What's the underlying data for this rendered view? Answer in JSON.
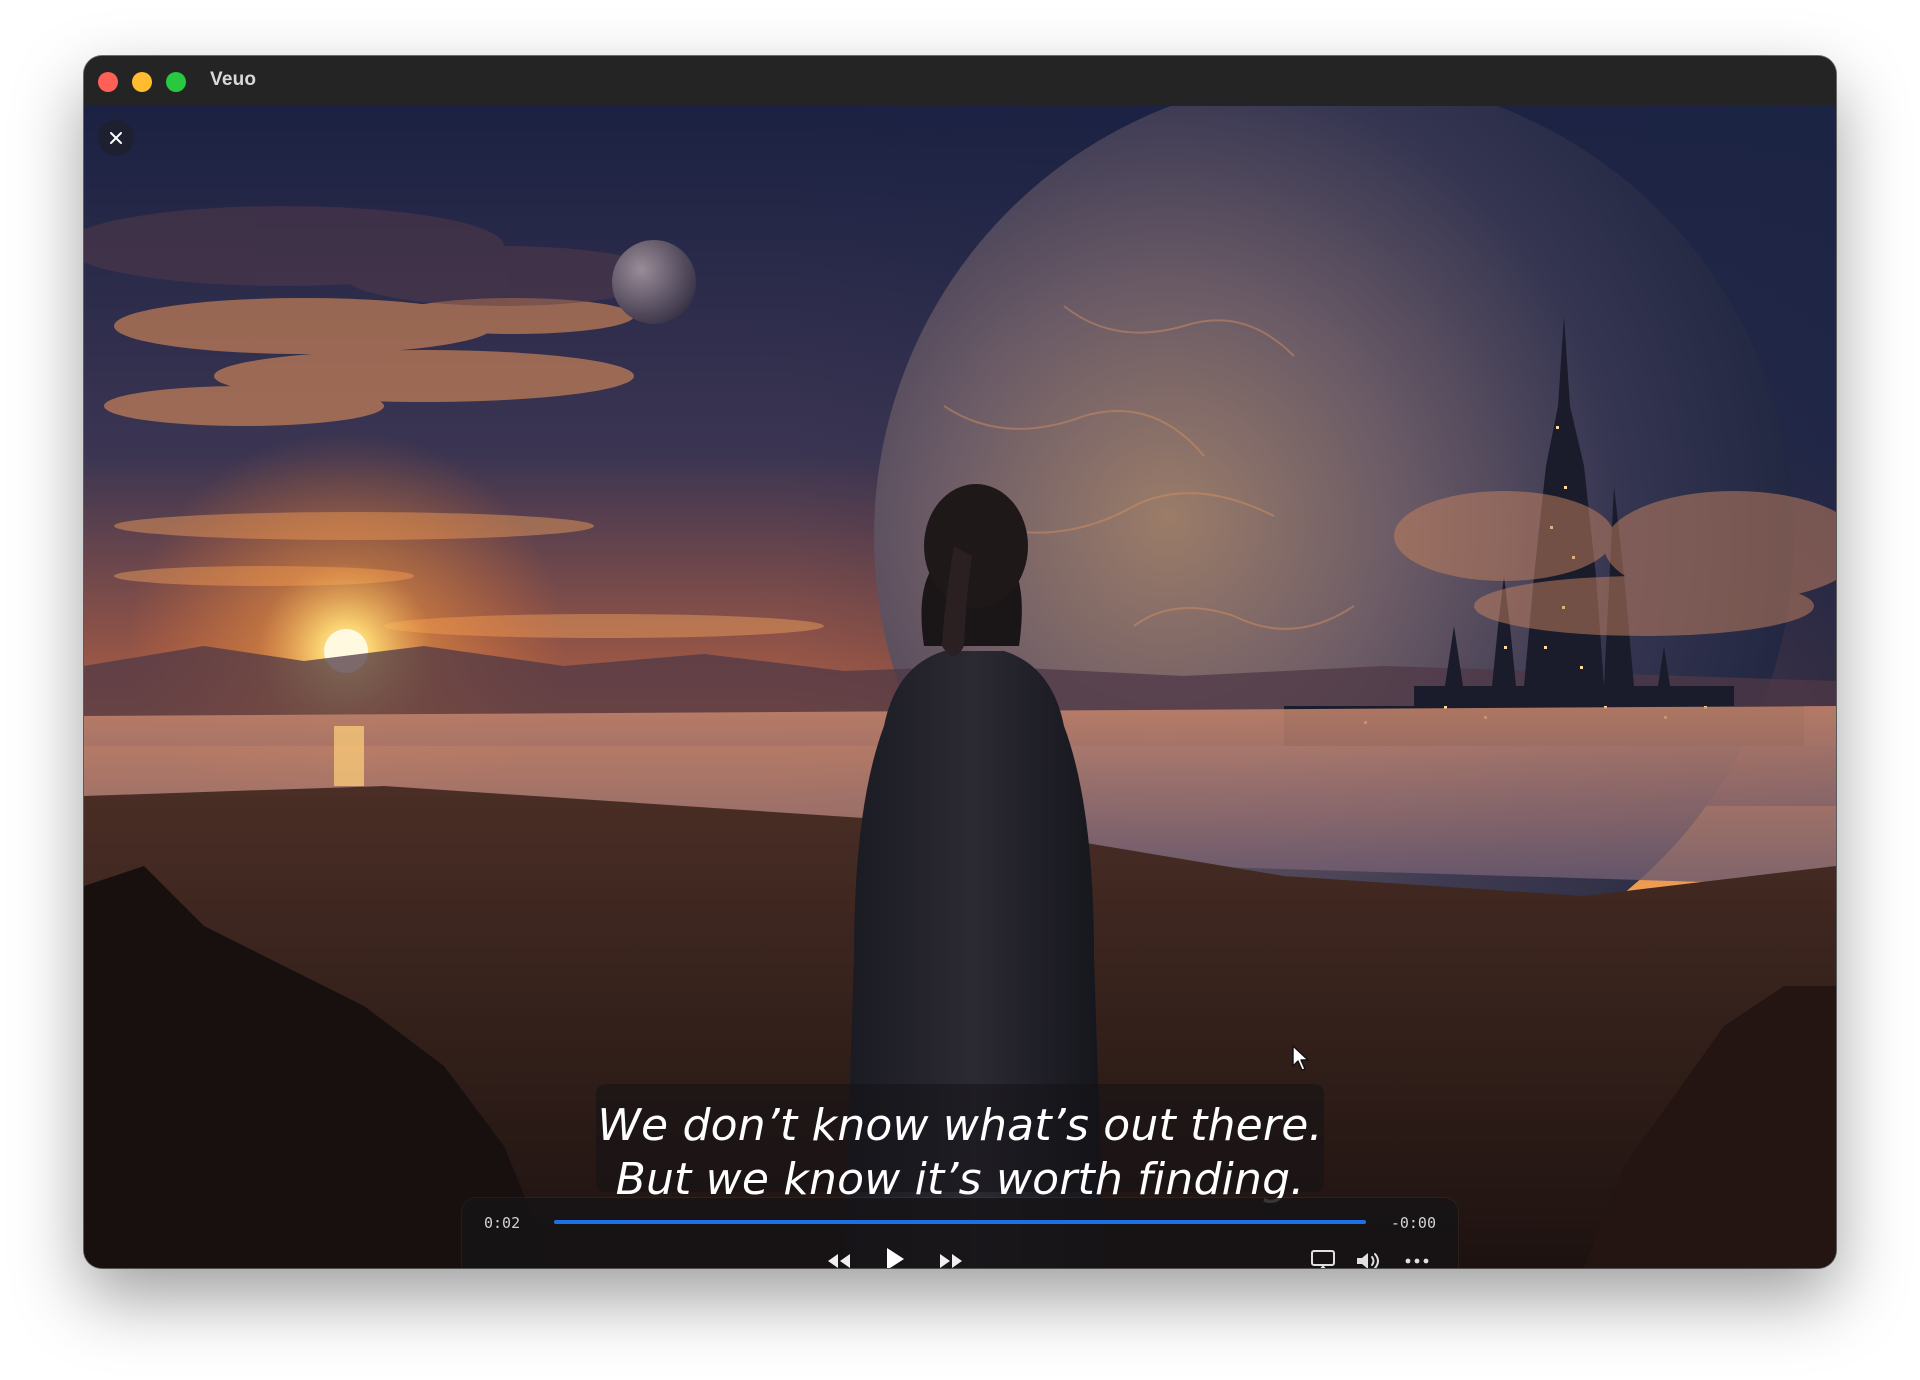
{
  "window": {
    "title": "Veuo"
  },
  "video": {
    "icons": {
      "close": "close-icon",
      "rewind": "rewind-icon",
      "play": "play-icon",
      "fast_forward": "fast-forward-icon",
      "airplay": "airplay-icon",
      "volume": "volume-icon",
      "more": "more-icon"
    }
  },
  "subtitles": {
    "line1": "We don’t know what’s out there.",
    "line2": "But we know it’s worth finding."
  },
  "player": {
    "elapsed": "0:02",
    "remaining": "-0:00",
    "progress": 1.0
  },
  "colors": {
    "accent": "#1f6fe5",
    "traffic_close": "#fe5f57",
    "traffic_minimize": "#febc2e",
    "traffic_zoom": "#28c840"
  }
}
